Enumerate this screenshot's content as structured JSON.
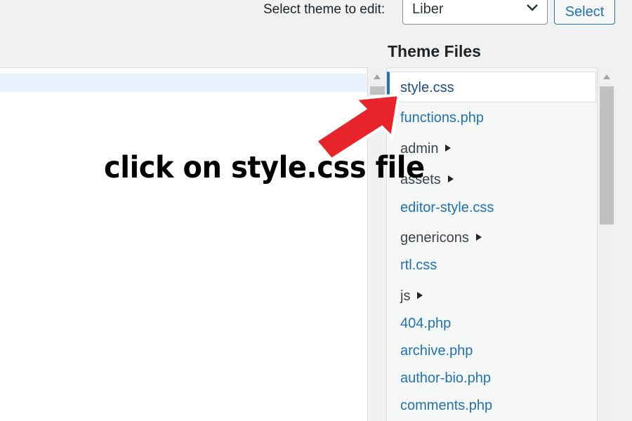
{
  "toolbar": {
    "select_label": "Select theme to edit:",
    "selected_theme": "Liber",
    "select_button": "Select"
  },
  "files": {
    "heading": "Theme Files",
    "items": [
      {
        "label": "style.css",
        "type": "file",
        "active": true
      },
      {
        "label": "functions.php",
        "type": "file"
      },
      {
        "label": "admin",
        "type": "folder"
      },
      {
        "label": "assets",
        "type": "folder"
      },
      {
        "label": "editor-style.css",
        "type": "file"
      },
      {
        "label": "genericons",
        "type": "folder"
      },
      {
        "label": "rtl.css",
        "type": "file"
      },
      {
        "label": "js",
        "type": "folder"
      },
      {
        "label": "404.php",
        "type": "file"
      },
      {
        "label": "archive.php",
        "type": "file"
      },
      {
        "label": "author-bio.php",
        "type": "file"
      },
      {
        "label": "comments.php",
        "type": "file"
      }
    ]
  },
  "annotation": {
    "text": "click on style.css file",
    "arrow_color": "#e8242a"
  },
  "colors": {
    "link": "#2271b1",
    "active_marker": "#2271b1",
    "editor_highlight": "#e8f2ff"
  }
}
